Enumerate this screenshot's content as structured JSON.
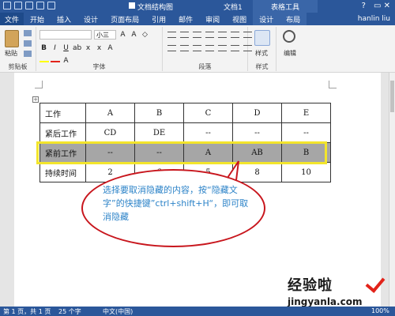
{
  "titlebar": {
    "doc_map_label": "文档结构图",
    "doc_title": "文档1",
    "context_tab": "表格工具",
    "minimize": "?",
    "window_controls": "▭  ✕"
  },
  "tabs": [
    "文件",
    "开始",
    "插入",
    "设计",
    "页面布局",
    "引用",
    "邮件",
    "审阅",
    "视图",
    "设计",
    "布局"
  ],
  "user": "hanlin liu",
  "ribbon": {
    "paste_label": "粘贴",
    "clipboard_label": "剪贴板",
    "font_label": "字体",
    "font_size": "小三",
    "paragraph_label": "段落",
    "styles_button": "样式",
    "styles_label": "样式",
    "editing_button": "编辑"
  },
  "table": {
    "rows": [
      {
        "label": "工作",
        "cells": [
          "A",
          "B",
          "C",
          "D",
          "E"
        ]
      },
      {
        "label": "紧后工作",
        "cells": [
          "CD",
          "DE",
          "--",
          "--",
          "--"
        ]
      },
      {
        "label": "紧前工作",
        "cells": [
          "--",
          "--",
          "A",
          "AB",
          "B"
        ]
      },
      {
        "label": "持续时间",
        "cells": [
          "2",
          "6",
          "5",
          "8",
          "10"
        ]
      }
    ]
  },
  "callout": "选择要取消隐藏的内容，按“隐藏文字”的快捷键”ctrl+shift+H“，即可取消隐藏",
  "watermark": {
    "line1": "经验啦",
    "line2": "jingyanla.com"
  },
  "status": {
    "page": "第 1 页，共 1 页",
    "words": "25 个字",
    "lang": "中文(中国)",
    "zoom": "100%"
  }
}
